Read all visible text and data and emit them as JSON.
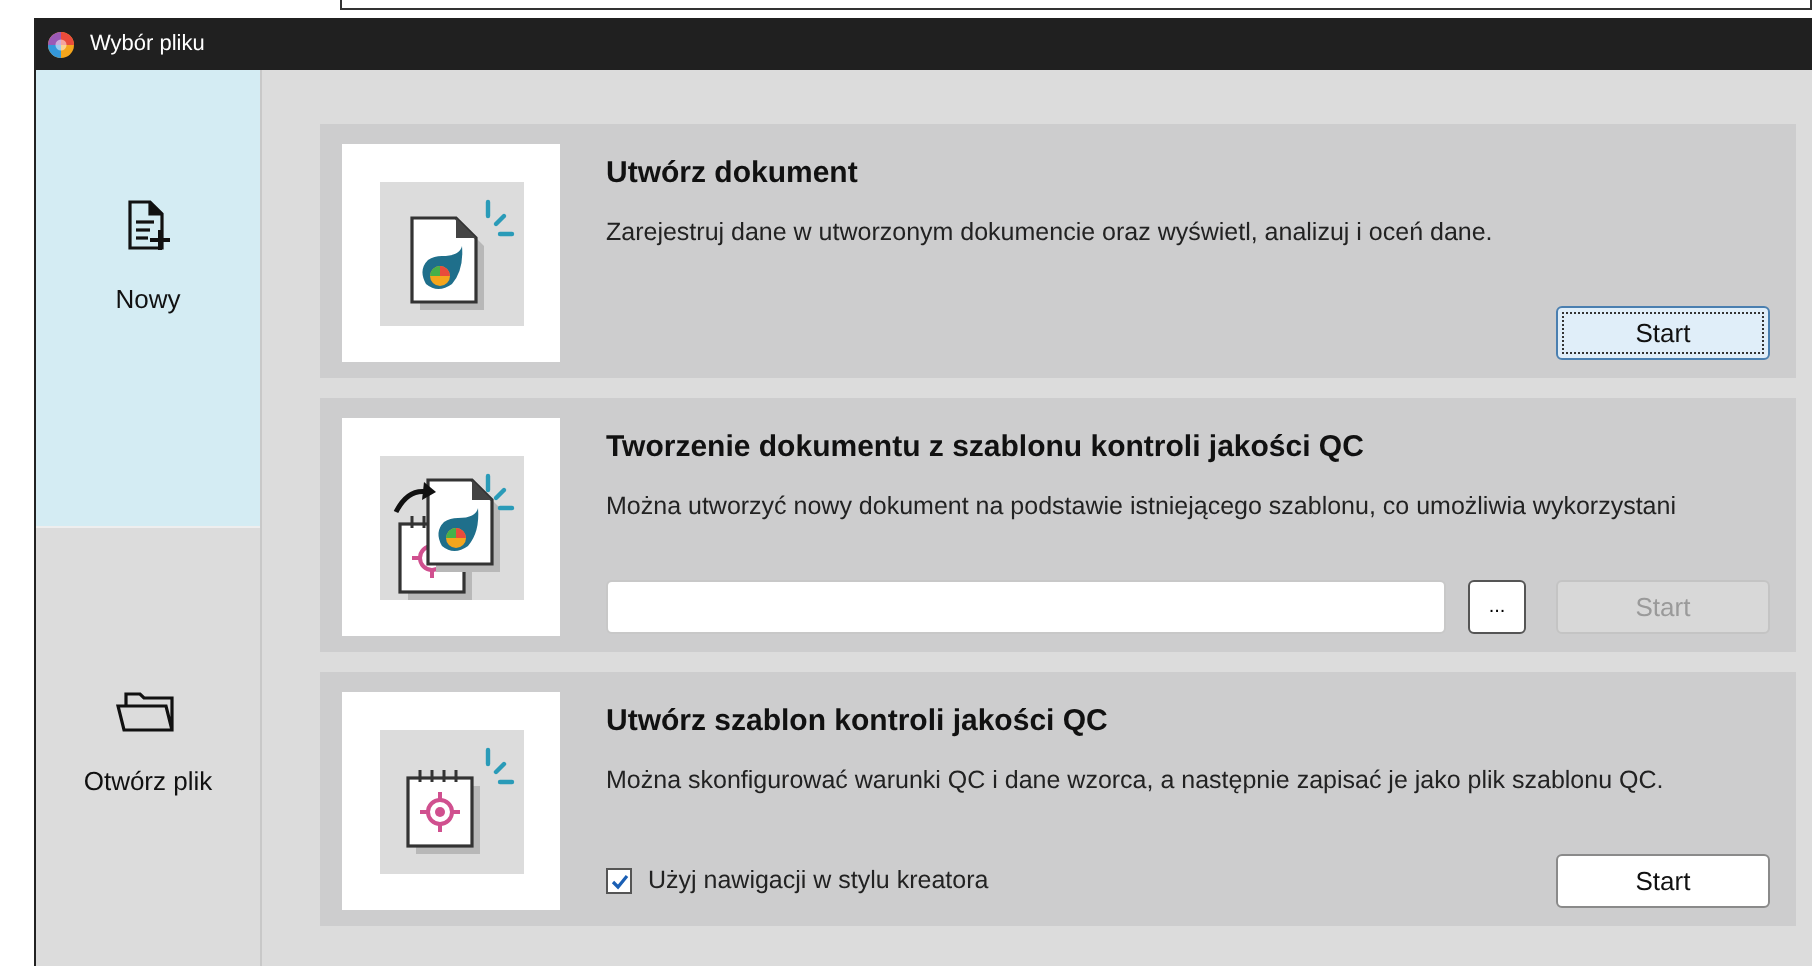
{
  "window": {
    "title": "Wybór pliku"
  },
  "sidebar": {
    "items": [
      {
        "kind": "new",
        "label": "Nowy",
        "selected": true
      },
      {
        "kind": "open",
        "label": "Otwórz plik",
        "selected": false
      }
    ]
  },
  "cards": [
    {
      "kind": "simple",
      "title": "Utwórz dokument",
      "description": "Zarejestruj dane w utworzonym dokumencie oraz wyświetl, analizuj i oceń dane.",
      "start": {
        "label": "Start",
        "disabled": false,
        "focused": true
      }
    },
    {
      "kind": "file",
      "title": "Tworzenie dokumentu z szablonu kontroli jakości QC",
      "description": "Można utworzyć nowy dokument na podstawie istniejącego szablonu, co umożliwia wykorzystani",
      "browse": "...",
      "start": {
        "label": "Start",
        "disabled": true,
        "focused": false
      }
    },
    {
      "kind": "checkbox",
      "title": "Utwórz szablon kontroli jakości QC",
      "description": "Można skonfigurować warunki QC i dane wzorca, a następnie zapisać je jako plik szablonu QC.",
      "option": {
        "label": "Użyj nawigacji w stylu kreatora",
        "checked": true
      },
      "start": {
        "label": "Start",
        "disabled": false,
        "focused": false
      }
    }
  ]
}
